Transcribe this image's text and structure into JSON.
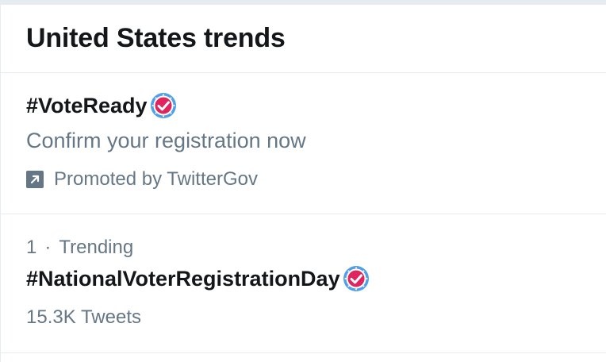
{
  "header": {
    "title": "United States trends"
  },
  "promoted": {
    "hashtag": "#VoteReady",
    "description": "Confirm your registration now",
    "promoted_by": "Promoted by TwitterGov",
    "badge_icon": "vote-checkmark-badge",
    "promo_icon": "promoted-arrow-icon"
  },
  "trends": [
    {
      "rank": "1",
      "label": "Trending",
      "hashtag": "#NationalVoterRegistrationDay",
      "tweets": "15.3K Tweets",
      "badge_icon": "vote-checkmark-badge"
    }
  ],
  "colors": {
    "text_primary": "#14171a",
    "text_secondary": "#657786",
    "divider": "#e6ecf0",
    "badge_blue": "#4ea0e8",
    "badge_red": "#e0245e"
  }
}
